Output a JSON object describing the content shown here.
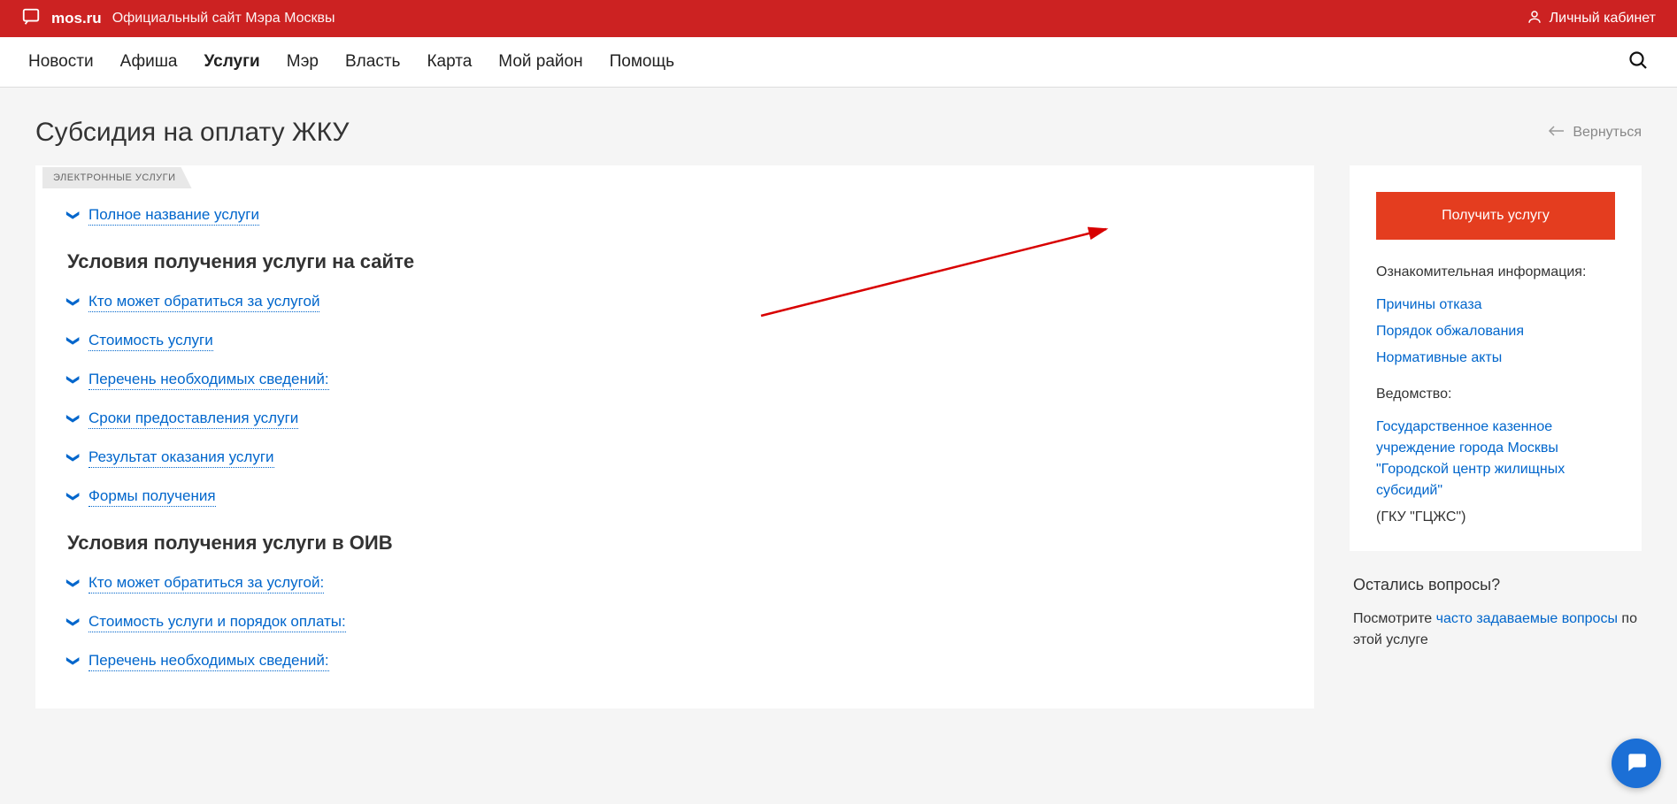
{
  "topbar": {
    "site_name": "mos.ru",
    "tagline": "Официальный сайт Мэра Москвы",
    "account_label": "Личный кабинет"
  },
  "nav": {
    "items": [
      "Новости",
      "Афиша",
      "Услуги",
      "Мэр",
      "Власть",
      "Карта",
      "Мой район",
      "Помощь"
    ],
    "active_index": 2
  },
  "page": {
    "title": "Субсидия на оплату ЖКУ",
    "back_label": "Вернуться",
    "tab_badge": "ЭЛЕКТРОННЫЕ УСЛУГИ"
  },
  "main": {
    "top_items": [
      "Полное название услуги"
    ],
    "section1_heading": "Условия получения услуги на сайте",
    "section1_items": [
      "Кто может обратиться за услугой",
      "Стоимость услуги",
      "Перечень необходимых сведений:",
      "Сроки предоставления услуги",
      "Результат оказания услуги",
      "Формы получения"
    ],
    "section2_heading": "Условия получения услуги в ОИВ",
    "section2_items": [
      "Кто может обратиться за услугой:",
      "Стоимость услуги и порядок оплаты:",
      "Перечень необходимых сведений:"
    ]
  },
  "sidebar": {
    "cta_label": "Получить услугу",
    "info_heading": "Ознакомительная информация:",
    "info_links": [
      "Причины отказа",
      "Порядок обжалования",
      "Нормативные акты"
    ],
    "agency_heading": "Ведомство:",
    "agency_link": "Государственное казенное учреждение города Москвы \"Городской центр жилищных субсидий\"",
    "agency_note": "(ГКУ \"ГЦЖС\")",
    "faq_heading": "Остались вопросы?",
    "faq_prefix": "Посмотрите ",
    "faq_link": "часто задаваемые вопросы",
    "faq_suffix": " по этой услуге"
  }
}
